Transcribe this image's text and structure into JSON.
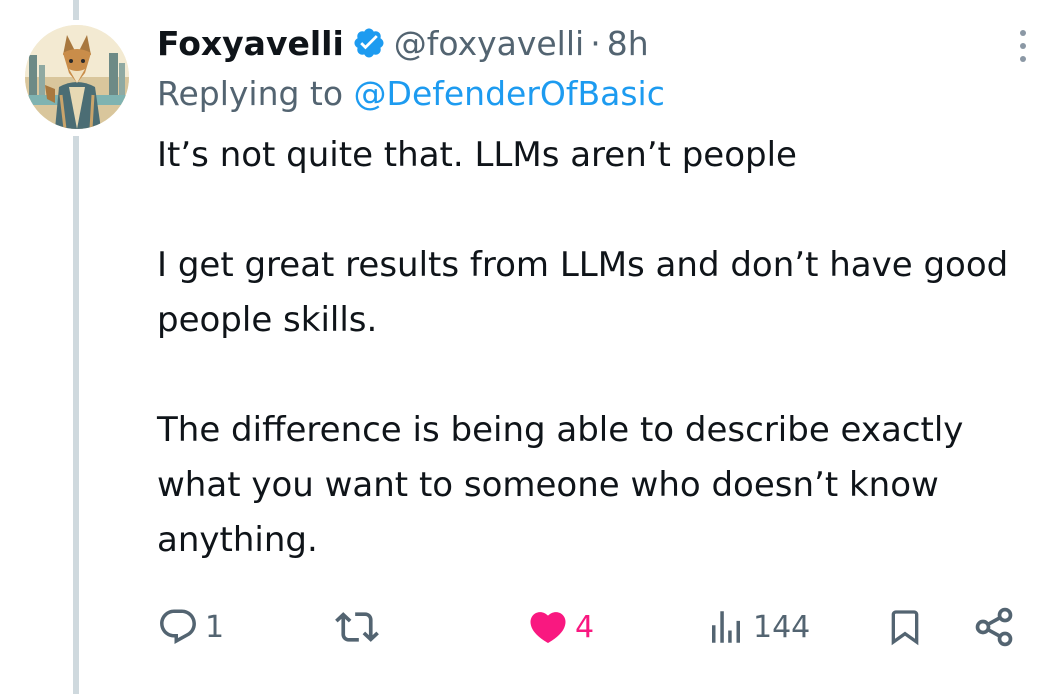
{
  "author": {
    "display_name": "Foxyavelli",
    "handle": "@foxyavelli",
    "separator": "·",
    "time": "8h",
    "verified": true,
    "avatar_icon": "fox-avatar"
  },
  "reply": {
    "prefix": "Replying to",
    "target": "@DefenderOfBasic"
  },
  "text": {
    "paragraph1": "It’s not quite that. LLMs aren’t people",
    "paragraph2": "I get great results from LLMs and don’t have good people skills.",
    "paragraph3": "The difference is being able to describe exactly what you want to someone who doesn’t know anything."
  },
  "actions": {
    "reply": {
      "icon": "reply-icon",
      "count": "1"
    },
    "retweet": {
      "icon": "retweet-icon",
      "count": ""
    },
    "like": {
      "icon": "heart-icon",
      "count": "4",
      "liked": true
    },
    "views": {
      "icon": "views-icon",
      "count": "144"
    },
    "bookmark": {
      "icon": "bookmark-icon"
    },
    "share": {
      "icon": "share-icon"
    }
  },
  "colors": {
    "link": "#1d9bf0",
    "like": "#f91880",
    "muted": "#536471",
    "text": "#0f1419",
    "thread_line": "#cfd9de"
  }
}
